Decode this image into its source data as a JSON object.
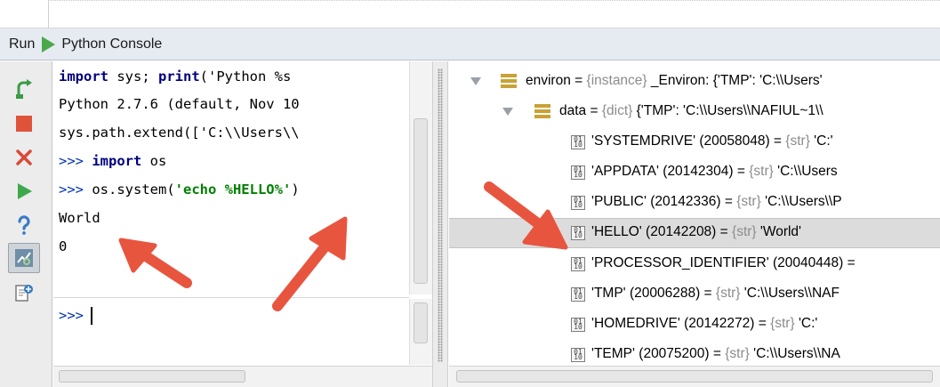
{
  "header": {
    "run_label": "Run",
    "title": "Python Console"
  },
  "toolbar": {
    "icons": [
      "rerun-icon",
      "stop-icon",
      "close-icon",
      "execute-icon",
      "help-icon",
      "show-variables-icon",
      "attach-debugger-icon"
    ],
    "colors": {
      "rerun": "#3c9a47",
      "stop": "#e0533b",
      "close": "#d94a3a",
      "execute": "#3ea84a",
      "help": "#3a7cc3"
    }
  },
  "console": {
    "lines": [
      {
        "segments": [
          {
            "text": "import",
            "style": "kw"
          },
          {
            "text": " sys; ",
            "style": "plain"
          },
          {
            "text": "print",
            "style": "kw"
          },
          {
            "text": "('Python %s",
            "style": "plain"
          }
        ]
      },
      {
        "segments": [
          {
            "text": "Python 2.7.6 (default, Nov 10",
            "style": "plain"
          }
        ]
      },
      {
        "segments": [
          {
            "text": "sys.path.extend(['C:\\\\Users\\\\",
            "style": "plain"
          }
        ]
      },
      {
        "segments": [
          {
            "text": ">>> ",
            "style": "prompt"
          },
          {
            "text": "import",
            "style": "kw"
          },
          {
            "text": " os",
            "style": "plain"
          }
        ]
      },
      {
        "segments": [
          {
            "text": ">>> ",
            "style": "prompt"
          },
          {
            "text": "os.system(",
            "style": "plain"
          },
          {
            "text": "'echo %HELLO%'",
            "style": "str"
          },
          {
            "text": ")",
            "style": "plain"
          }
        ]
      },
      {
        "segments": [
          {
            "text": "World",
            "style": "plain"
          }
        ]
      },
      {
        "segments": [
          {
            "text": "0",
            "style": "plain"
          }
        ]
      }
    ],
    "prompt": ">>>"
  },
  "variables": {
    "rows": [
      {
        "indent": 0,
        "expander": "expanded",
        "icon": "field-icon",
        "name": "environ",
        "eq": " = ",
        "type": "{instance}",
        "value": " _Environ: {'TMP': 'C:\\\\Users'",
        "selected": false
      },
      {
        "indent": 1,
        "expander": "expanded",
        "icon": "field-icon",
        "name": "data",
        "eq": " = ",
        "type": "{dict}",
        "value": " {'TMP': 'C:\\\\Users\\\\NAFIUL~1\\\\",
        "selected": false
      },
      {
        "indent": 2,
        "expander": "none",
        "icon": "binary-icon",
        "name": "'SYSTEMDRIVE' (20058048)",
        "eq": " = ",
        "type": "{str}",
        "value": " 'C:'",
        "selected": false
      },
      {
        "indent": 2,
        "expander": "none",
        "icon": "binary-icon",
        "name": "'APPDATA' (20142304)",
        "eq": " = ",
        "type": "{str}",
        "value": " 'C:\\\\Users",
        "selected": false
      },
      {
        "indent": 2,
        "expander": "none",
        "icon": "binary-icon",
        "name": "'PUBLIC' (20142336)",
        "eq": " = ",
        "type": "{str}",
        "value": " 'C:\\\\Users\\\\P",
        "selected": false
      },
      {
        "indent": 2,
        "expander": "none",
        "icon": "binary-icon",
        "name": "'HELLO' (20142208)",
        "eq": " = ",
        "type": "{str}",
        "value": " 'World'",
        "selected": true
      },
      {
        "indent": 2,
        "expander": "none",
        "icon": "binary-icon",
        "name": "'PROCESSOR_IDENTIFIER' (20040448)",
        "eq": " =",
        "type": "",
        "value": "",
        "selected": false
      },
      {
        "indent": 2,
        "expander": "none",
        "icon": "binary-icon",
        "name": "'TMP' (20006288)",
        "eq": " = ",
        "type": "{str}",
        "value": " 'C:\\\\Users\\\\NAF",
        "selected": false
      },
      {
        "indent": 2,
        "expander": "none",
        "icon": "binary-icon",
        "name": "'HOMEDRIVE' (20142272)",
        "eq": " = ",
        "type": "{str}",
        "value": " 'C:'",
        "selected": false
      },
      {
        "indent": 2,
        "expander": "none",
        "icon": "binary-icon",
        "name": "'TEMP' (20075200)",
        "eq": " = ",
        "type": "{str}",
        "value": " 'C:\\\\Users\\\\NA",
        "selected": false
      }
    ]
  },
  "annotations": {
    "arrow_color": "#e8553f"
  }
}
